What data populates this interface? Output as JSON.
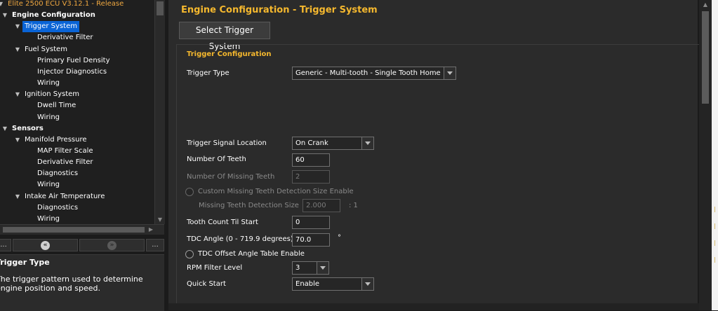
{
  "app": {
    "title": "Elite 2500 ECU V3.12.1 - Release"
  },
  "tree": {
    "items": [
      {
        "label": "Elite 2500 ECU V3.12.1 - Release",
        "level": 0,
        "expanded": true,
        "selected": false
      },
      {
        "label": "Engine Configuration",
        "level": 1,
        "expanded": true,
        "selected": false
      },
      {
        "label": "Trigger System",
        "level": 2,
        "expanded": true,
        "selected": true
      },
      {
        "label": "Derivative Filter",
        "level": 3,
        "expanded": false,
        "selected": false
      },
      {
        "label": "Fuel System",
        "level": 2,
        "expanded": true,
        "selected": false
      },
      {
        "label": "Primary Fuel Density",
        "level": 3,
        "expanded": false,
        "selected": false
      },
      {
        "label": "Injector Diagnostics",
        "level": 3,
        "expanded": false,
        "selected": false
      },
      {
        "label": "Wiring",
        "level": 3,
        "expanded": false,
        "selected": false
      },
      {
        "label": "Ignition System",
        "level": 2,
        "expanded": true,
        "selected": false
      },
      {
        "label": "Dwell Time",
        "level": 3,
        "expanded": false,
        "selected": false
      },
      {
        "label": "Wiring",
        "level": 3,
        "expanded": false,
        "selected": false
      },
      {
        "label": "Sensors",
        "level": 1,
        "expanded": true,
        "selected": false
      },
      {
        "label": "Manifold Pressure",
        "level": 2,
        "expanded": true,
        "selected": false
      },
      {
        "label": "MAP Filter Scale",
        "level": 3,
        "expanded": false,
        "selected": false
      },
      {
        "label": "Derivative Filter",
        "level": 3,
        "expanded": false,
        "selected": false
      },
      {
        "label": "Diagnostics",
        "level": 3,
        "expanded": false,
        "selected": false
      },
      {
        "label": "Wiring",
        "level": 3,
        "expanded": false,
        "selected": false
      },
      {
        "label": "Intake Air Temperature",
        "level": 2,
        "expanded": true,
        "selected": false
      },
      {
        "label": "Diagnostics",
        "level": 3,
        "expanded": false,
        "selected": false
      },
      {
        "label": "Wiring",
        "level": 3,
        "expanded": false,
        "selected": false
      }
    ]
  },
  "nav": {
    "first_label": "...",
    "last_label": "...",
    "back_glyph": "«",
    "forward_glyph": "»"
  },
  "help": {
    "title": "Trigger Type",
    "text": "The trigger pattern used to determine engine position and speed."
  },
  "main": {
    "title": "Engine Configuration - Trigger System",
    "select_button": "Select Trigger System",
    "group_title": "Trigger Configuration",
    "trigger_type": {
      "label": "Trigger Type",
      "value": "Generic - Multi-tooth - Single Tooth Home"
    },
    "trigger_signal_location": {
      "label": "Trigger Signal Location",
      "value": "On Crank"
    },
    "number_of_teeth": {
      "label": "Number Of Teeth",
      "value": "60"
    },
    "number_of_missing_teeth": {
      "label": "Number Of Missing Teeth",
      "value": "2"
    },
    "custom_missing_enable": {
      "label": "Custom Missing Teeth Detection Size Enable",
      "checked": false
    },
    "missing_teeth_detection_size": {
      "label": "Missing Teeth Detection Size",
      "value": "2.000",
      "unit": ": 1"
    },
    "tooth_count_til_start": {
      "label": "Tooth Count Til Start",
      "value": "0"
    },
    "tdc_angle": {
      "label": "TDC Angle (0 - 719.9 degrees)",
      "value": "70.0",
      "unit": "°"
    },
    "tdc_offset_enable": {
      "label": "TDC Offset Angle Table Enable",
      "checked": false
    },
    "rpm_filter_level": {
      "label": "RPM Filter Level",
      "value": "3"
    },
    "quick_start": {
      "label": "Quick Start",
      "value": "Enable"
    }
  },
  "colors": {
    "accent": "#f5b82e",
    "selection": "#0a64d6",
    "panel_bg": "#2b2b2b"
  }
}
